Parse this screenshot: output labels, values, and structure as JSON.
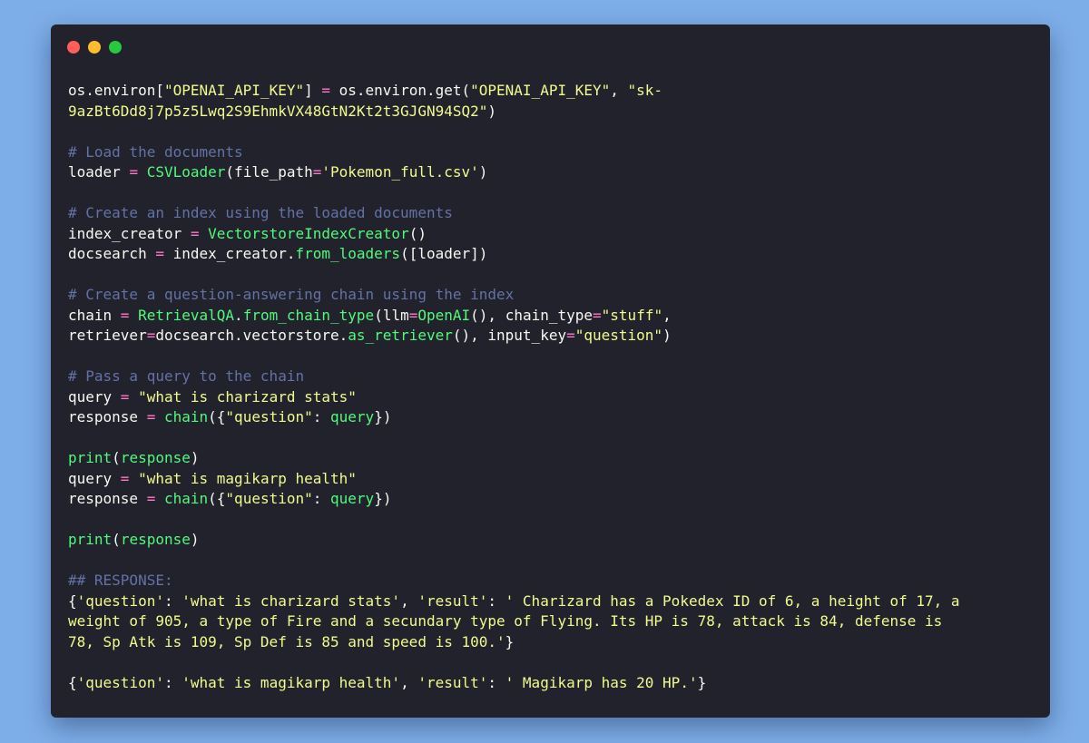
{
  "window": {
    "traffic_lights": {
      "close": "#ff5f57",
      "minimize": "#febc2e",
      "zoom": "#28c840"
    }
  },
  "colors": {
    "background": "#7eaee8",
    "editor_bg": "#22222d",
    "text": "#f8f8f2",
    "operator": "#ff79c6",
    "string": "#f1fa8c",
    "function": "#50fa7b",
    "comment": "#6272a4"
  },
  "code_lines": [
    [
      [
        "plain",
        "os.environ["
      ],
      [
        "str",
        "\"OPENAI_API_KEY\""
      ],
      [
        "plain",
        "] "
      ],
      [
        "op",
        "="
      ],
      [
        "plain",
        " os.environ.get("
      ],
      [
        "str",
        "\"OPENAI_API_KEY\""
      ],
      [
        "plain",
        ", "
      ],
      [
        "str",
        "\"sk-"
      ]
    ],
    [
      [
        "str",
        "9azBt6Dd8j7p5z5Lwq2S9EhmkVX48GtN2Kt2t3GJGN94SQ2\""
      ],
      [
        "plain",
        ")"
      ]
    ],
    [],
    [
      [
        "comment",
        "# Load the documents"
      ]
    ],
    [
      [
        "plain",
        "loader "
      ],
      [
        "op",
        "="
      ],
      [
        "plain",
        " "
      ],
      [
        "func",
        "CSVLoader"
      ],
      [
        "plain",
        "(file_path"
      ],
      [
        "op",
        "="
      ],
      [
        "str",
        "'Pokemon_full.csv'"
      ],
      [
        "plain",
        ")"
      ]
    ],
    [],
    [
      [
        "comment",
        "# Create an index using the loaded documents"
      ]
    ],
    [
      [
        "plain",
        "index_creator "
      ],
      [
        "op",
        "="
      ],
      [
        "plain",
        " "
      ],
      [
        "func",
        "VectorstoreIndexCreator"
      ],
      [
        "plain",
        "()"
      ]
    ],
    [
      [
        "plain",
        "docsearch "
      ],
      [
        "op",
        "="
      ],
      [
        "plain",
        " index_creator."
      ],
      [
        "func",
        "from_loaders"
      ],
      [
        "plain",
        "([loader])"
      ]
    ],
    [],
    [
      [
        "comment",
        "# Create a question-answering chain using the index"
      ]
    ],
    [
      [
        "plain",
        "chain "
      ],
      [
        "op",
        "="
      ],
      [
        "plain",
        " "
      ],
      [
        "func",
        "RetrievalQA"
      ],
      [
        "plain",
        "."
      ],
      [
        "func",
        "from_chain_type"
      ],
      [
        "plain",
        "(llm"
      ],
      [
        "op",
        "="
      ],
      [
        "func",
        "OpenAI"
      ],
      [
        "plain",
        "(), chain_type"
      ],
      [
        "op",
        "="
      ],
      [
        "str",
        "\"stuff\""
      ],
      [
        "plain",
        ","
      ]
    ],
    [
      [
        "plain",
        "retriever"
      ],
      [
        "op",
        "="
      ],
      [
        "plain",
        "docsearch.vectorstore."
      ],
      [
        "func",
        "as_retriever"
      ],
      [
        "plain",
        "(), input_key"
      ],
      [
        "op",
        "="
      ],
      [
        "str",
        "\"question\""
      ],
      [
        "plain",
        ")"
      ]
    ],
    [],
    [
      [
        "comment",
        "# Pass a query to the chain"
      ]
    ],
    [
      [
        "plain",
        "query "
      ],
      [
        "op",
        "="
      ],
      [
        "plain",
        " "
      ],
      [
        "str",
        "\"what is charizard stats\""
      ]
    ],
    [
      [
        "plain",
        "response "
      ],
      [
        "op",
        "="
      ],
      [
        "plain",
        " "
      ],
      [
        "func",
        "chain"
      ],
      [
        "plain",
        "({"
      ],
      [
        "str",
        "\"question\""
      ],
      [
        "plain",
        ": "
      ],
      [
        "func",
        "query"
      ],
      [
        "plain",
        "})"
      ]
    ],
    [],
    [
      [
        "func",
        "print"
      ],
      [
        "plain",
        "("
      ],
      [
        "func",
        "response"
      ],
      [
        "plain",
        ")"
      ]
    ],
    [
      [
        "plain",
        "query "
      ],
      [
        "op",
        "="
      ],
      [
        "plain",
        " "
      ],
      [
        "str",
        "\"what is magikarp health\""
      ]
    ],
    [
      [
        "plain",
        "response "
      ],
      [
        "op",
        "="
      ],
      [
        "plain",
        " "
      ],
      [
        "func",
        "chain"
      ],
      [
        "plain",
        "({"
      ],
      [
        "str",
        "\"question\""
      ],
      [
        "plain",
        ": "
      ],
      [
        "func",
        "query"
      ],
      [
        "plain",
        "})"
      ]
    ],
    [],
    [
      [
        "func",
        "print"
      ],
      [
        "plain",
        "("
      ],
      [
        "func",
        "response"
      ],
      [
        "plain",
        ")"
      ]
    ],
    [],
    [
      [
        "comment",
        "## RESPONSE:"
      ]
    ],
    [
      [
        "plain",
        "{"
      ],
      [
        "str",
        "'question'"
      ],
      [
        "plain",
        ": "
      ],
      [
        "str",
        "'what is charizard stats'"
      ],
      [
        "plain",
        ", "
      ],
      [
        "str",
        "'result'"
      ],
      [
        "plain",
        ": "
      ],
      [
        "str",
        "' Charizard has a Pokedex ID of 6, a height of 17, a"
      ]
    ],
    [
      [
        "str",
        "weight of 905, a type of Fire and a secundary type of Flying. Its HP is 78, attack is 84, defense is"
      ]
    ],
    [
      [
        "str",
        "78, Sp Atk is 109, Sp Def is 85 and speed is 100.'"
      ],
      [
        "plain",
        "}"
      ]
    ],
    [],
    [
      [
        "plain",
        "{"
      ],
      [
        "str",
        "'question'"
      ],
      [
        "plain",
        ": "
      ],
      [
        "str",
        "'what is magikarp health'"
      ],
      [
        "plain",
        ", "
      ],
      [
        "str",
        "'result'"
      ],
      [
        "plain",
        ": "
      ],
      [
        "str",
        "' Magikarp has 20 HP.'"
      ],
      [
        "plain",
        "}"
      ]
    ]
  ]
}
